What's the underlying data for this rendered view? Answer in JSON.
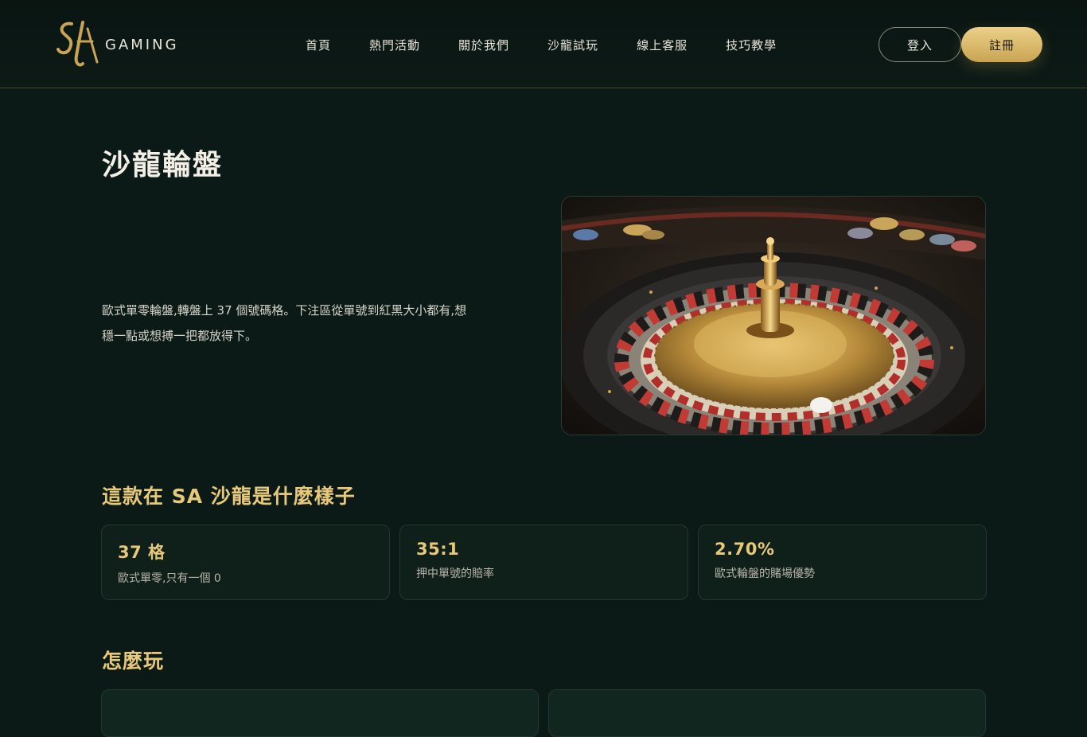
{
  "header": {
    "logo_mark": "SA",
    "logo_text": "GAMING",
    "nav": [
      "首頁",
      "熱門活動",
      "關於我們",
      "沙龍試玩",
      "線上客服",
      "技巧教學"
    ],
    "login_label": "登入",
    "register_label": "註冊"
  },
  "main": {
    "title": "沙龍輪盤",
    "intro": "歐式單零輪盤,轉盤上 37 個號碼格。下注區從單號到紅黑大小都有,想穩一點或想搏一把都放得下。",
    "hero_image": "roulette-wheel-photo",
    "features_title": "這款在 SA 沙龍是什麼樣子",
    "stats": [
      {
        "value": "37 格",
        "label": "歐式單零,只有一個 0"
      },
      {
        "value": "35:1",
        "label": "押中單號的賠率"
      },
      {
        "value": "2.70%",
        "label": "歐式輪盤的賭場優勢"
      }
    ],
    "howto_title": "怎麼玩"
  },
  "colors": {
    "background": "#0b1a16",
    "accent_gold": "#e8c97a",
    "button_gold": "#d9b866",
    "card_bg": "#0f201b"
  }
}
